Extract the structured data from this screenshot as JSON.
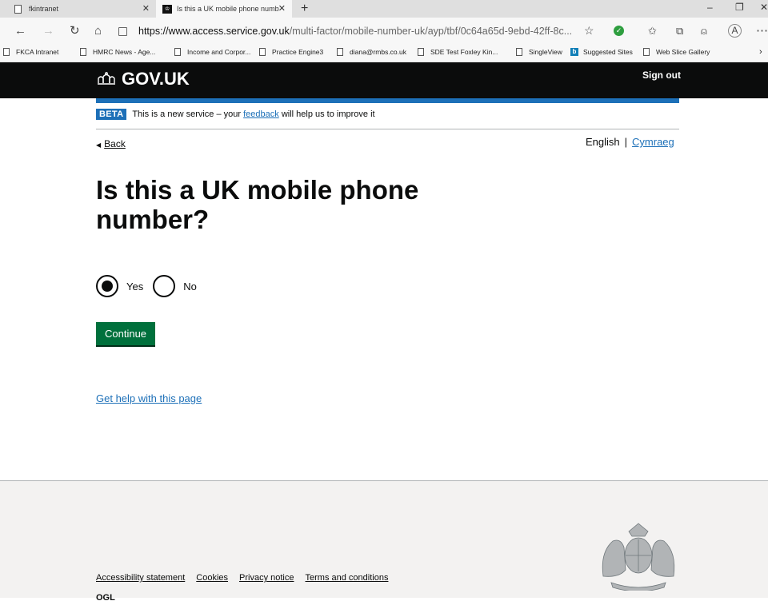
{
  "browser": {
    "tabs": [
      {
        "title": "fkintranet",
        "active": false
      },
      {
        "title": "Is this a UK mobile phone numb",
        "active": true
      }
    ],
    "url_host": "https://www.access.service.gov.uk",
    "url_rest": "/multi-factor/mobile-number-uk/ayp/tbf/0c64a65d-9ebd-42ff-8c...",
    "favorites": [
      "FKCA Intranet",
      "HMRC News - Age...",
      "Income and Corpor...",
      "Practice Engine3",
      "diana@rmbs.co.uk",
      "SDE Test Foxley Kin...",
      "SingleView",
      "Suggested Sites",
      "Web Slice Gallery"
    ]
  },
  "header": {
    "logo_text": "GOV.UK",
    "sign_out": "Sign out",
    "brand_color": "#1d70b8"
  },
  "phase_banner": {
    "tag": "BETA",
    "text_before": "This is a new service – your",
    "link": "feedback",
    "text_after": "will help us to improve it"
  },
  "nav": {
    "back": "Back",
    "lang_current": "English",
    "lang_other": "Cymraeg"
  },
  "main": {
    "heading": "Is this a UK mobile phone number?",
    "options": [
      {
        "label": "Yes",
        "selected": true
      },
      {
        "label": "No",
        "selected": false
      }
    ],
    "continue_label": "Continue",
    "help_link": "Get help with this page",
    "button_color": "#00703c"
  },
  "footer": {
    "links": [
      "Accessibility statement",
      "Cookies",
      "Privacy notice",
      "Terms and conditions"
    ],
    "ogl": "OGL"
  }
}
